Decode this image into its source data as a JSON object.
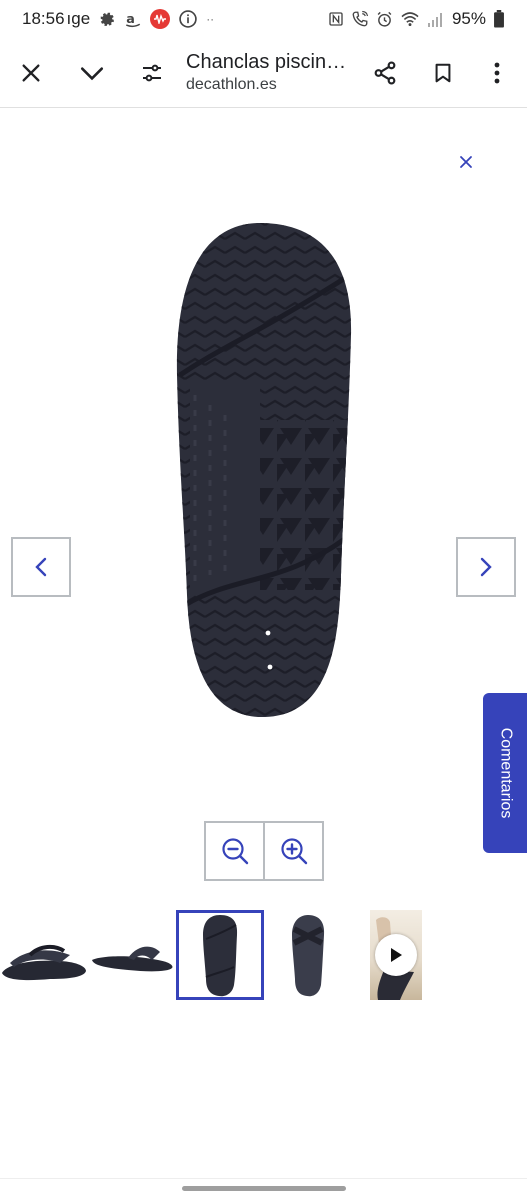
{
  "status_bar": {
    "time": "18:56",
    "carrier": "ıge",
    "battery": "95%",
    "dots": "··"
  },
  "toolbar": {
    "page_title": "Chanclas piscin…",
    "page_url": "decathlon.es"
  },
  "gallery": {
    "current_index": 3,
    "thumbnails": [
      {
        "kind": "image",
        "subject": "pair of sandals, side view"
      },
      {
        "kind": "image",
        "subject": "sandal, side profile"
      },
      {
        "kind": "image",
        "subject": "sandal sole, bottom view",
        "selected": true
      },
      {
        "kind": "image",
        "subject": "sandal, top view"
      },
      {
        "kind": "video",
        "subject": "sandal worn on foot"
      }
    ]
  },
  "comments_tab": {
    "label": "Comentarios"
  },
  "colors": {
    "brand": "#3643ba",
    "sole": "#2c2e3a",
    "border": "#b8bcc0"
  }
}
